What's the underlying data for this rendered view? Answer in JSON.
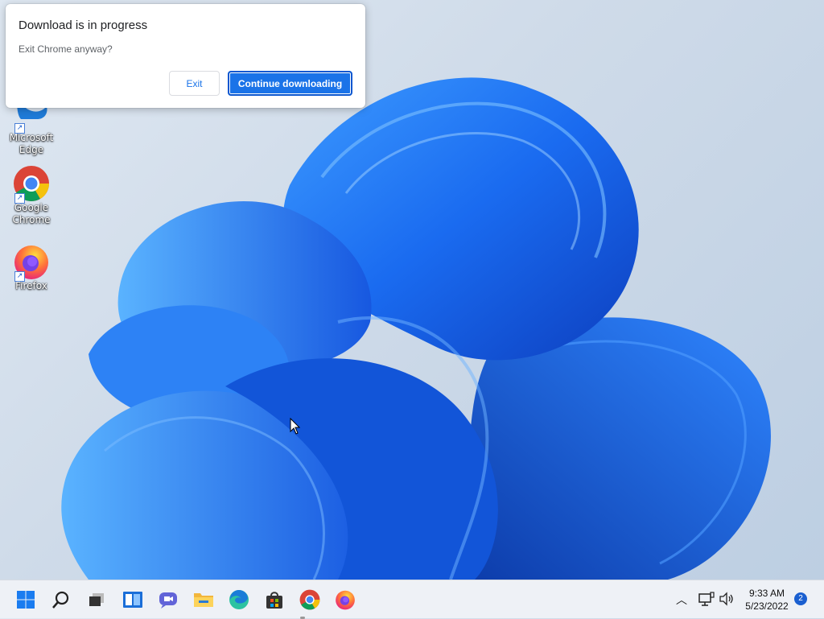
{
  "dialog": {
    "title": "Download is in progress",
    "message": "Exit Chrome anyway?",
    "exit_label": "Exit",
    "continue_label": "Continue downloading"
  },
  "desktop_icons": [
    {
      "label_line1": "Microsoft",
      "label_line2": "Edge",
      "icon": "edge-icon"
    },
    {
      "label_line1": "Google",
      "label_line2": "Chrome",
      "icon": "chrome-icon"
    },
    {
      "label_line1": "Firefox",
      "label_line2": "",
      "icon": "firefox-icon"
    }
  ],
  "taskbar": {
    "items": [
      "start-icon",
      "search-icon",
      "task-view-icon",
      "widgets-icon",
      "chat-icon",
      "file-explorer-icon",
      "edge-icon",
      "store-icon",
      "chrome-icon",
      "firefox-icon"
    ],
    "time": "9:33 AM",
    "date": "5/23/2022",
    "notification_count": "2"
  },
  "colors": {
    "accent": "#1a73e8",
    "taskbar_bg": "#eef1f6",
    "wallpaper_blue": "#1e6cf0"
  }
}
